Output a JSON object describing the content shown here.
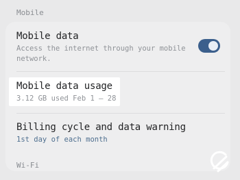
{
  "section_mobile": "Mobile",
  "mobile_data": {
    "title": "Mobile data",
    "subtitle": "Access the internet through your mobile network.",
    "toggle_on": true
  },
  "usage": {
    "title": "Mobile data usage",
    "subtitle": "3.12 GB used Feb 1 – 28"
  },
  "billing": {
    "title": "Billing cycle and data warning",
    "subtitle": "1st day of each month"
  },
  "section_wifi": "Wi-Fi",
  "colors": {
    "accent": "#3b5f8c",
    "highlight": "#ffffff"
  },
  "icons": {
    "watermark": "logo-icon"
  }
}
